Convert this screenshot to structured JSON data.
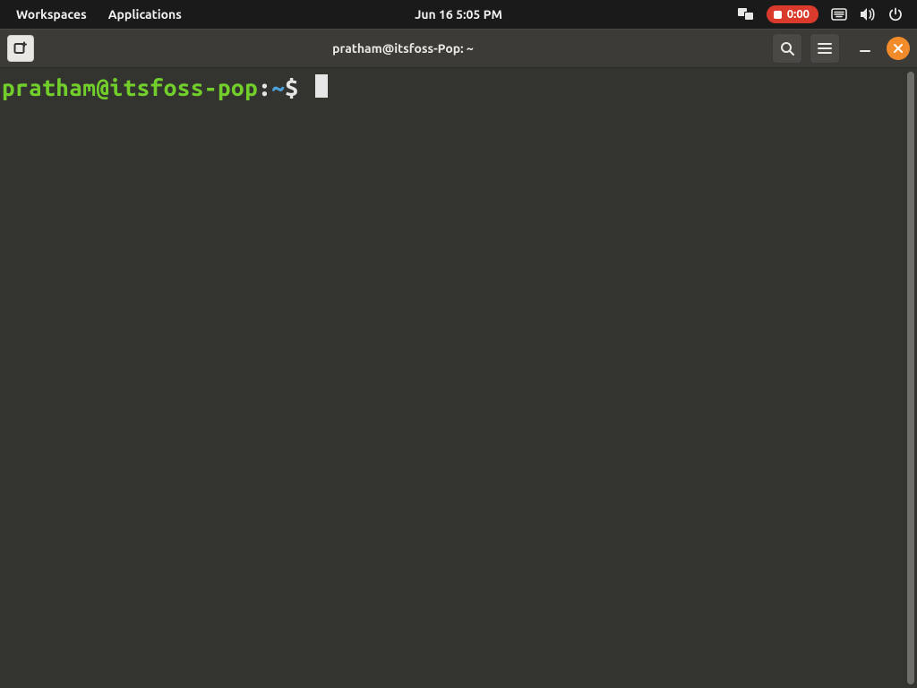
{
  "topbar": {
    "workspaces_label": "Workspaces",
    "applications_label": "Applications",
    "clock": "Jun 16   5:05 PM",
    "recording_time": "0:00",
    "icons": {
      "windows": "windows-overview-icon",
      "language": "input-source-icon",
      "volume": "speaker-icon",
      "power": "power-icon"
    }
  },
  "window": {
    "title": "pratham@itsfoss-Pop: ~",
    "icons": {
      "new_tab": "new-tab-icon",
      "search": "search-icon",
      "menu": "hamburger-menu-icon",
      "minimize": "minimize-icon",
      "close": "close-icon"
    }
  },
  "terminal": {
    "user_host": "pratham@itsfoss-pop",
    "sep": ":",
    "path": "~",
    "prompt_symbol": "$",
    "input": ""
  },
  "colors": {
    "prompt_user": "#72cf2b",
    "prompt_path": "#4ea0d8",
    "bg": "#333330",
    "accent_close": "#f28c2a",
    "accent_rec": "#d93a2b"
  }
}
